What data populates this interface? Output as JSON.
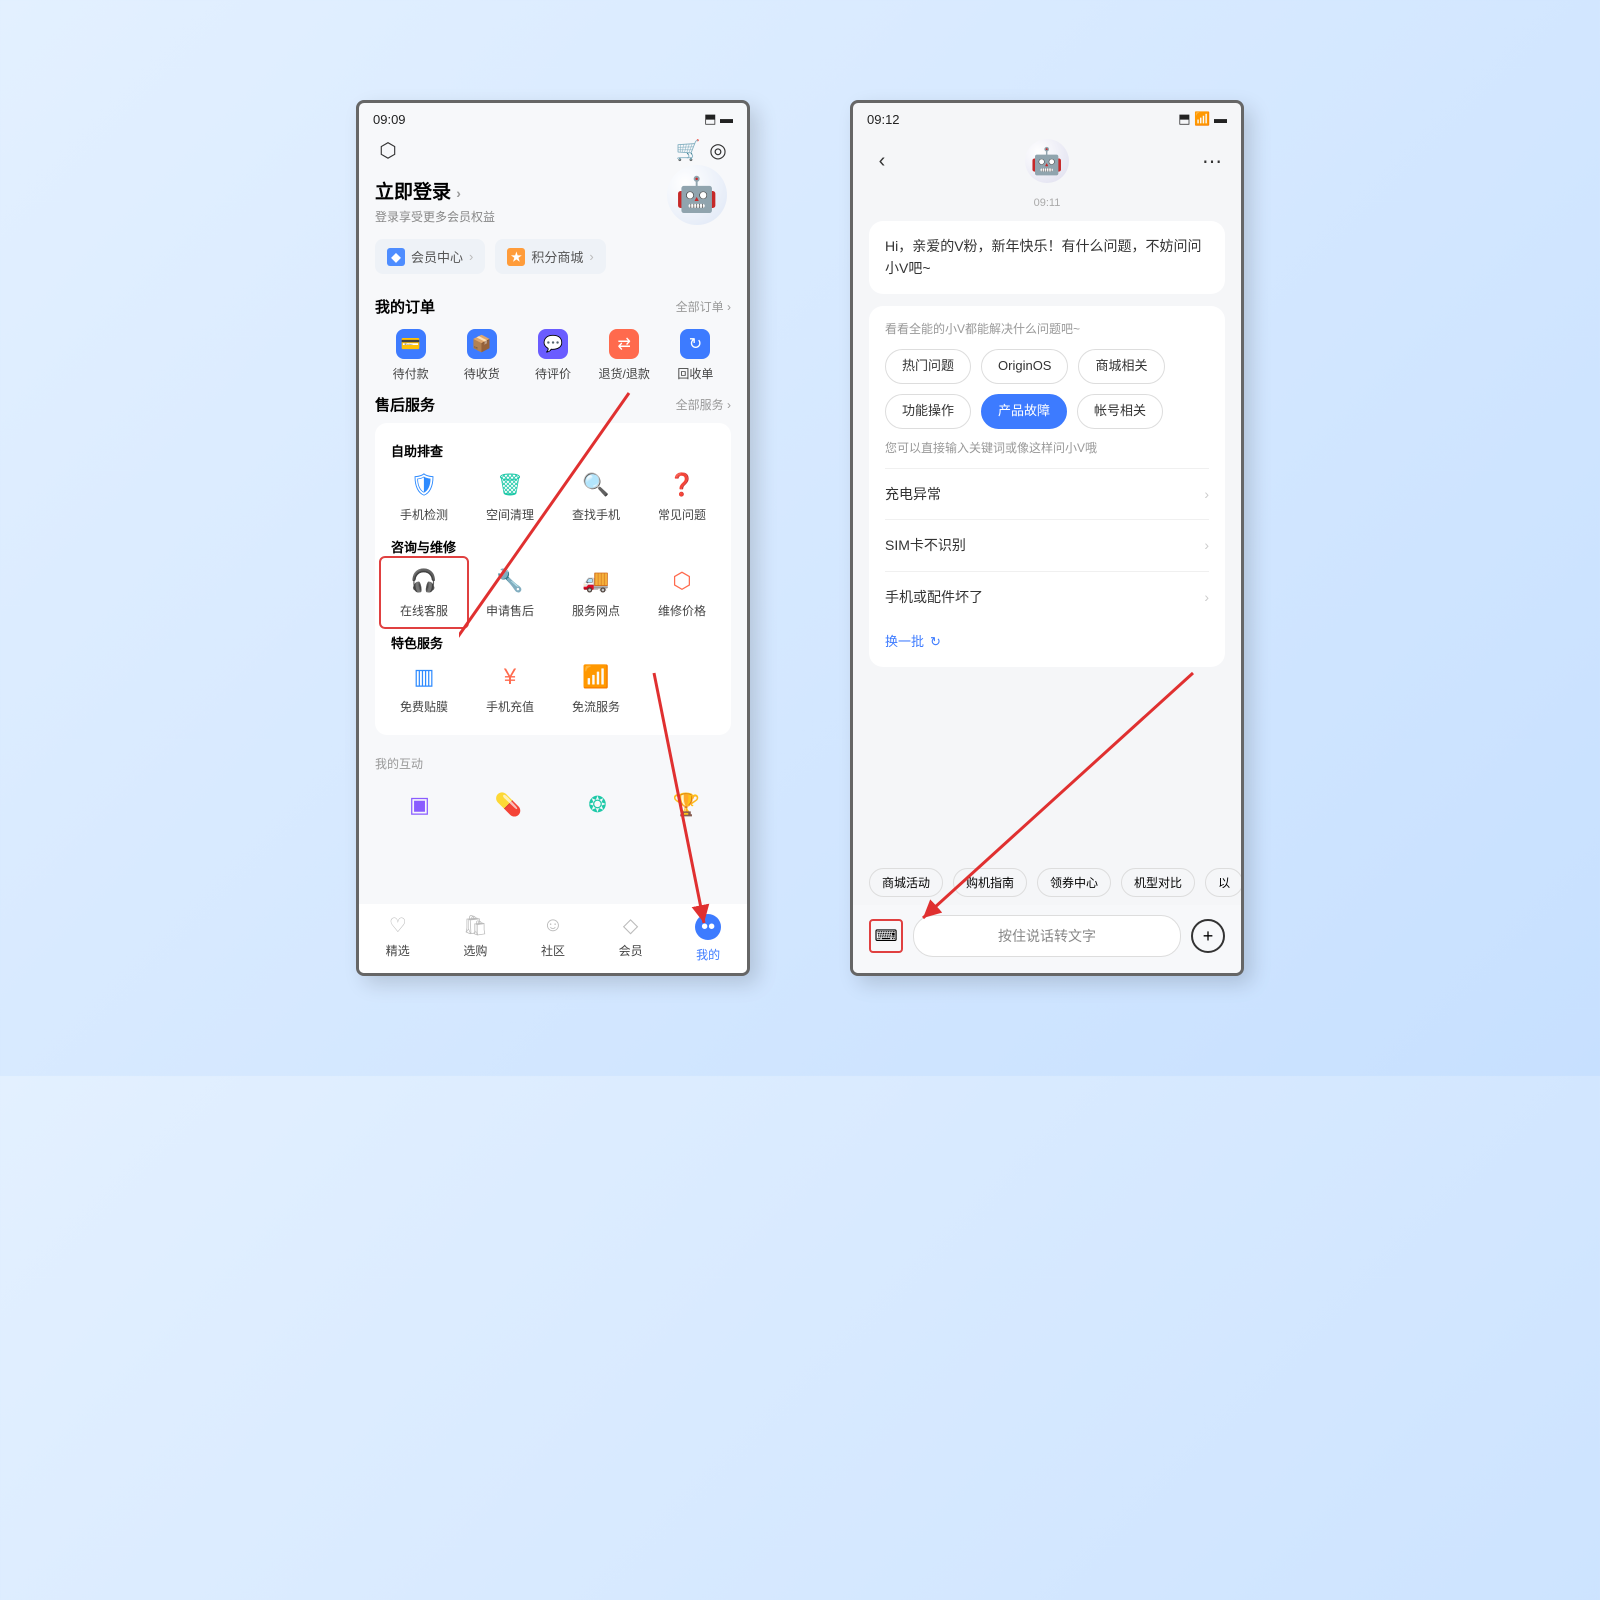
{
  "left": {
    "status": {
      "time": "09:09",
      "right": "⬒ ▬"
    },
    "login": {
      "title": "立即登录",
      "sub": "登录享受更多会员权益"
    },
    "chips": [
      {
        "icon": "◆",
        "color": "#4e8dff",
        "label": "会员中心"
      },
      {
        "icon": "★",
        "color": "#ff9c3a",
        "label": "积分商城"
      }
    ],
    "orders": {
      "title": "我的订单",
      "more": "全部订单 ›",
      "items": [
        {
          "label": "待付款",
          "color": "#3d7bff",
          "ic": "💳"
        },
        {
          "label": "待收货",
          "color": "#3d7bff",
          "ic": "📦"
        },
        {
          "label": "待评价",
          "color": "#6a5cff",
          "ic": "💬"
        },
        {
          "label": "退货/退款",
          "color": "#ff6a4d",
          "ic": "⇄"
        },
        {
          "label": "回收单",
          "color": "#3d7bff",
          "ic": "↻"
        }
      ]
    },
    "service": {
      "title": "售后服务",
      "more": "全部服务 ›",
      "g1": {
        "title": "自助排查",
        "items": [
          {
            "label": "手机检测",
            "ic": "🛡",
            "c": "#2e8bff"
          },
          {
            "label": "空间清理",
            "ic": "🗑",
            "c": "#1ec9a8"
          },
          {
            "label": "查找手机",
            "ic": "🔍",
            "c": "#ff8a3d"
          },
          {
            "label": "常见问题",
            "ic": "❓",
            "c": "#ffb03a"
          }
        ]
      },
      "g2": {
        "title": "咨询与维修",
        "items": [
          {
            "label": "在线客服",
            "ic": "🎧",
            "c": "#1ec9a8",
            "hl": true
          },
          {
            "label": "申请售后",
            "ic": "🔧",
            "c": "#8a5cff"
          },
          {
            "label": "服务网点",
            "ic": "🚚",
            "c": "#ff9c3a"
          },
          {
            "label": "维修价格",
            "ic": "⬡",
            "c": "#ff6a4d"
          }
        ]
      },
      "g3": {
        "title": "特色服务",
        "items": [
          {
            "label": "免费贴膜",
            "ic": "▥",
            "c": "#2e8bff"
          },
          {
            "label": "手机充值",
            "ic": "¥",
            "c": "#ff6a4d"
          },
          {
            "label": "免流服务",
            "ic": "📶",
            "c": "#ffb03a"
          }
        ]
      }
    },
    "interact": {
      "title": "我的互动",
      "items": [
        "▣",
        "💊",
        "❂",
        "🏆"
      ]
    },
    "tabs": [
      {
        "label": "精选",
        "ic": "♡"
      },
      {
        "label": "选购",
        "ic": "🛍"
      },
      {
        "label": "社区",
        "ic": "☺"
      },
      {
        "label": "会员",
        "ic": "◇"
      },
      {
        "label": "我的",
        "ic": "••",
        "active": true
      }
    ]
  },
  "right": {
    "status": {
      "time": "09:12",
      "right": "⬒ 📶 ▬"
    },
    "time": "09:11",
    "greeting": "Hi，亲爱的V粉，新年快乐！有什么问题，不妨问问小V吧~",
    "prompt": "看看全能的小V都能解决什么问题吧~",
    "tags": [
      "热门问题",
      "OriginOS",
      "商城相关",
      "功能操作",
      "产品故障",
      "帐号相关"
    ],
    "tagActive": 4,
    "hint": "您可以直接输入关键词或像这样问小V哦",
    "qs": [
      "充电异常",
      "SIM卡不识别",
      "手机或配件坏了"
    ],
    "refresh": "换一批",
    "pills": [
      "商城活动",
      "购机指南",
      "领券中心",
      "机型对比",
      "以"
    ],
    "input": "按住说话转文字"
  }
}
